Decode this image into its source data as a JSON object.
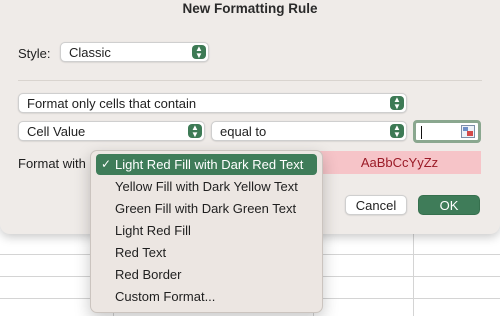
{
  "dialog": {
    "title": "New Formatting Rule",
    "style_label": "Style:",
    "style_value": "Classic",
    "rule_type": "Format only cells that contain",
    "condition_source": "Cell Value",
    "operator": "equal to",
    "value_input": "",
    "format_with_label": "Format with",
    "preview_text": "AaBbCcYyZz",
    "cancel_label": "Cancel",
    "ok_label": "OK"
  },
  "format_menu": {
    "check_mark": "✓",
    "items": [
      "Light Red Fill with Dark Red Text",
      "Yellow Fill with Dark Yellow Text",
      "Green Fill with Dark Green Text",
      "Light Red Fill",
      "Red Text",
      "Red Border",
      "Custom Format..."
    ],
    "selected_index": 0
  },
  "colors": {
    "accent": "#3f7c59",
    "preview_fill": "#f6c4c8",
    "preview_text": "#9b1b27"
  }
}
